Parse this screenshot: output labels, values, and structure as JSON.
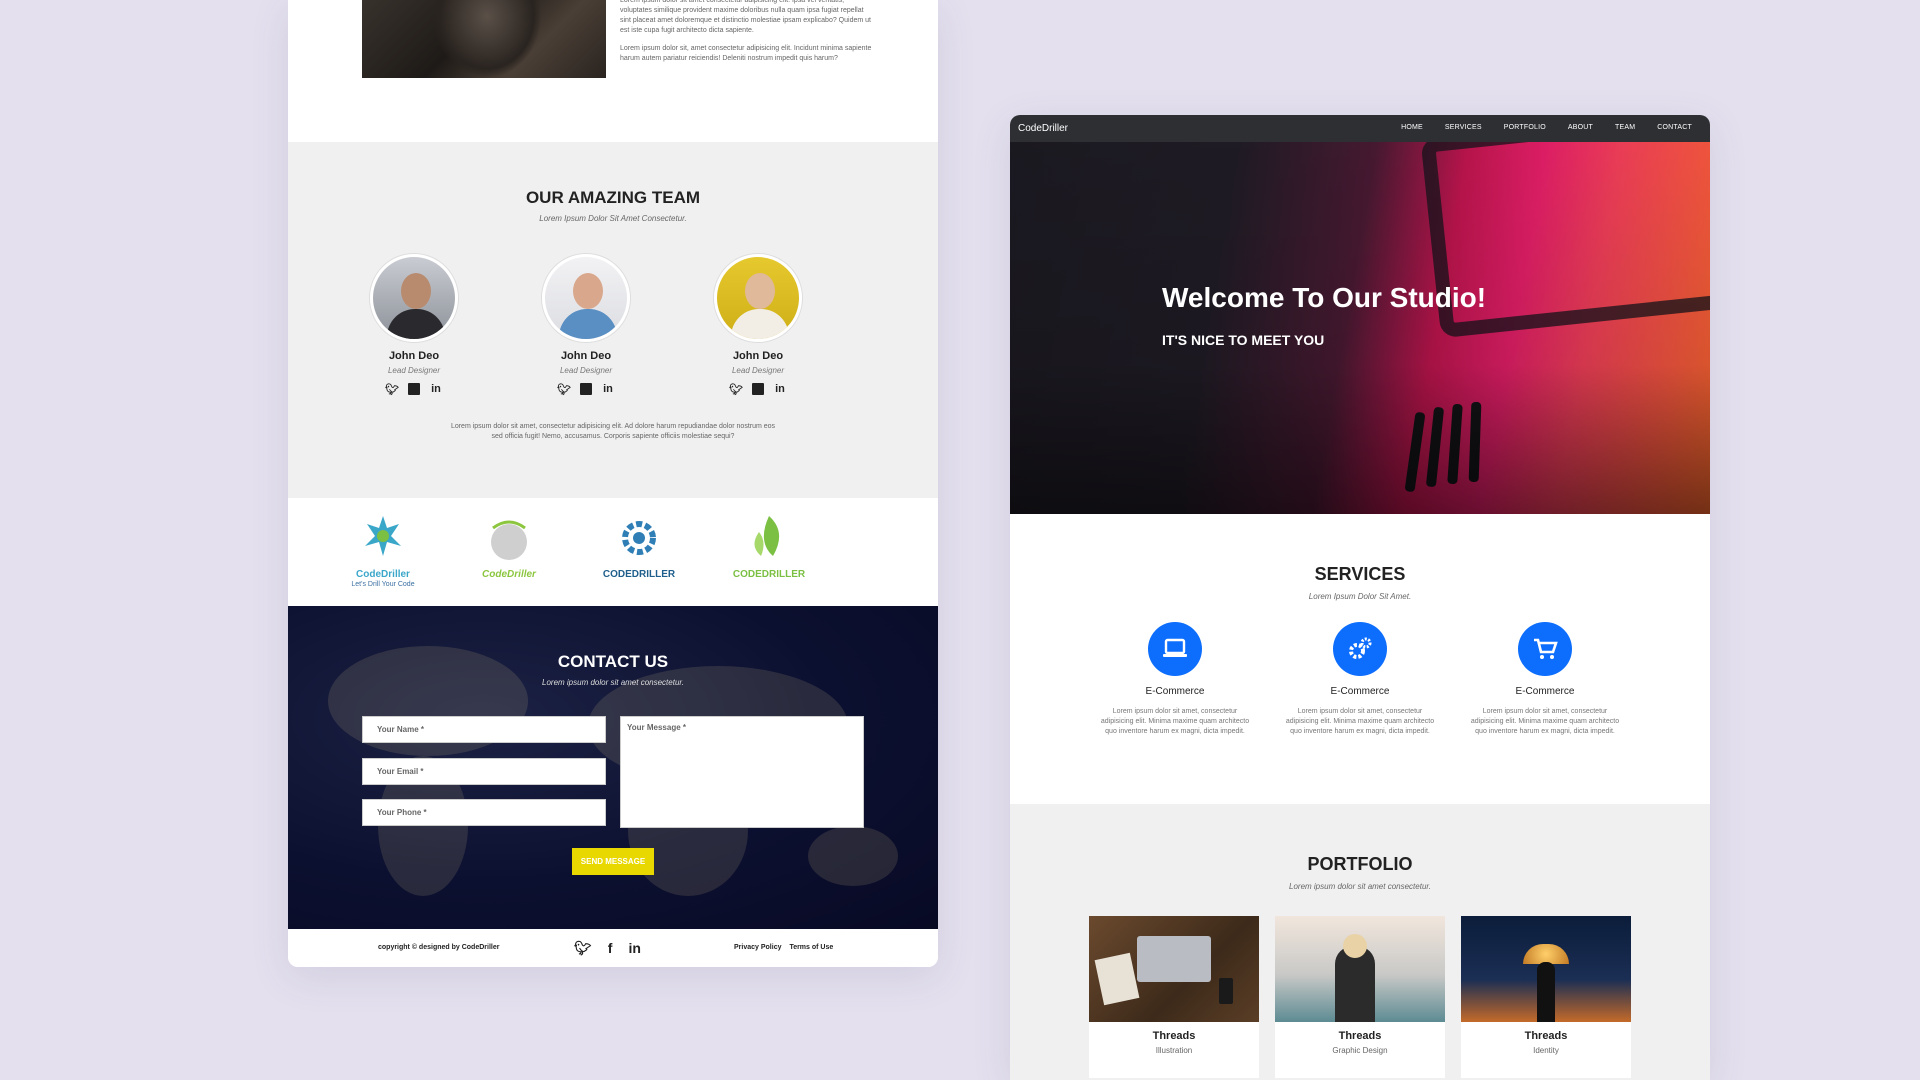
{
  "left": {
    "about": {
      "p1": "Lorem ipsum dolor sit amet consectetur adipisicing elit. Ipsa vel veritatis, voluptates similique provident maxime doloribus nulla quam ipsa fugiat repellat sint placeat amet doloremque et distinctio molestiae ipsam explicabo? Quidem ut est iste cupa fugit architecto dicta sapiente.",
      "p2": "Lorem ipsum dolor sit, amet consectetur adipisicing elit. Incidunt minima sapiente harum autem pariatur reiciendis! Deleniti nostrum impedit quis harum?"
    },
    "team": {
      "title": "OUR AMAZING TEAM",
      "subtitle": "Lorem Ipsum Dolor Sit Amet Consectetur.",
      "members": [
        {
          "name": "John Deo",
          "role": "Lead Designer"
        },
        {
          "name": "John Deo",
          "role": "Lead Designer"
        },
        {
          "name": "John Deo",
          "role": "Lead Designer"
        }
      ],
      "social_icons": [
        "twitter-icon",
        "facebook-icon",
        "linkedin-icon"
      ],
      "description": "Lorem ipsum dolor sit amet, consectetur adipisicing elit. Ad dolore harum repudiandae dolor nostrum eos sed officia fugit! Nemo, accusamus. Corporis sapiente officiis molestiae sequi?"
    },
    "clients": [
      {
        "name": "CodeDriller",
        "tagline": "Let's Drill Your Code"
      },
      {
        "name": "CodeDriller",
        "tagline": ""
      },
      {
        "name": "CODEDRILLER",
        "tagline": ""
      },
      {
        "name": "CODEDRILLER",
        "tagline": ""
      }
    ],
    "contact": {
      "title": "CONTACT US",
      "subtitle": "Lorem ipsum dolor sit amet consectetur.",
      "name_placeholder": "Your Name *",
      "email_placeholder": "Your Email *",
      "phone_placeholder": "Your Phone *",
      "message_placeholder": "Your Message *",
      "send_label": "SEND MESSAGE"
    },
    "footer": {
      "copyright": "copyright © designed by CodeDriller",
      "privacy": "Privacy Policy",
      "terms": "Terms of Use"
    }
  },
  "right": {
    "nav": {
      "brand": "CodeDriller",
      "items": [
        "HOME",
        "SERVICES",
        "PORTFOLIO",
        "ABOUT",
        "TEAM",
        "CONTACT"
      ]
    },
    "hero": {
      "title": "Welcome To Our Studio!",
      "subtitle": "IT'S NICE TO MEET YOU"
    },
    "services": {
      "title": "SERVICES",
      "subtitle": "Lorem Ipsum Dolor Sit Amet.",
      "items": [
        {
          "icon": "laptop-icon",
          "title": "E-Commerce",
          "text": "Lorem ipsum dolor sit amet, consectetur adipisicing elit. Minima maxime quam architecto quo inventore harum ex magni, dicta impedit."
        },
        {
          "icon": "gears-icon",
          "title": "E-Commerce",
          "text": "Lorem ipsum dolor sit amet, consectetur adipisicing elit. Minima maxime quam architecto quo inventore harum ex magni, dicta impedit."
        },
        {
          "icon": "cart-icon",
          "title": "E-Commerce",
          "text": "Lorem ipsum dolor sit amet, consectetur adipisicing elit. Minima maxime quam architecto quo inventore harum ex magni, dicta impedit."
        }
      ]
    },
    "portfolio": {
      "title": "PORTFOLIO",
      "subtitle": "Lorem ipsum dolor sit amet consectetur.",
      "items": [
        {
          "title": "Threads",
          "category": "Illustration"
        },
        {
          "title": "Threads",
          "category": "Graphic Design"
        },
        {
          "title": "Threads",
          "category": "Identity"
        }
      ]
    }
  },
  "colors": {
    "background": "#e4e0ee",
    "accent_blue": "#0d6efd",
    "send_button": "#e8d800",
    "nav_bg": "#2d2f33",
    "section_gray": "#f0f0f0"
  }
}
